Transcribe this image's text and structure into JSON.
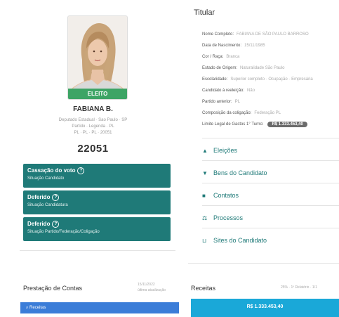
{
  "candidate": {
    "status_badge": "ELEITO",
    "name": "FABIANA B.",
    "detail_lines": [
      "Deputado Estadual · Sao Paulo · SP",
      "Partido · Legenda · PL",
      "PL · PL · PL · 20051"
    ],
    "number": "22051"
  },
  "status_cards": [
    {
      "title": "Cassação do voto",
      "subtitle": "Situação Candidato"
    },
    {
      "title": "Deferido",
      "subtitle": "Situação Candidatura"
    },
    {
      "title": "Deferido",
      "subtitle": "Situação Partido/Federação/Coligação"
    }
  ],
  "titular": {
    "heading": "Titular",
    "fields": [
      {
        "label": "Nome Completo:",
        "value": "FABIANA DE SÃO PAULO BARROSO"
      },
      {
        "label": "Data de Nascimento:",
        "value": "15/11/1985"
      },
      {
        "label": "Cor / Raça:",
        "value": "Branca"
      },
      {
        "label": "Estado de Origem:",
        "value": "Naturalidade São Paulo"
      },
      {
        "label": "Escolaridade:",
        "value": "Superior completo · Ocupação · Empresária"
      },
      {
        "label": "Candidato à reeleição:",
        "value": "Não"
      },
      {
        "label": "Partido anterior:",
        "value": "PL"
      },
      {
        "label": "Composição da coligação:",
        "value": "Federação PL"
      },
      {
        "label": "Limite Legal de Gastos 1° Turno:",
        "value": ""
      }
    ],
    "limit_button": "R$ 1.333.453,40"
  },
  "links": [
    {
      "icon": "eleicoes-icon",
      "label": "Eleições"
    },
    {
      "icon": "bens-icon",
      "label": "Bens do Candidato"
    },
    {
      "icon": "contatos-icon",
      "label": "Contatos"
    },
    {
      "icon": "processos-icon",
      "label": "Processos"
    },
    {
      "icon": "sites-icon",
      "label": "Sites do Candidato"
    }
  ],
  "prestacao": {
    "title": "Prestação de Contas",
    "meta_lines": [
      "15/11/2022",
      "última atualização"
    ],
    "button": "Receitas"
  },
  "receitas": {
    "title": "Receitas",
    "meta": "25% · 1º Relatório · 1/1",
    "button": "R$ 1.333.453,40"
  },
  "colors": {
    "teal": "#1f7a78",
    "green_badge": "#3da465",
    "blue_button": "#3b7dd8",
    "cyan_button": "#1aa8d8"
  }
}
